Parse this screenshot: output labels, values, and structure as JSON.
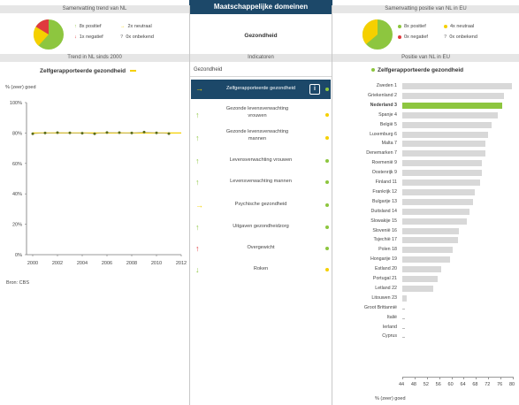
{
  "header": {
    "title": "Maatschappelijke domeinen",
    "left_summary_title": "Samenvatting trend van NL",
    "right_summary_title": "Samenvatting positie van NL in EU"
  },
  "trend_summary": {
    "items": [
      {
        "icon": "arrow-up-icon",
        "color": "#8dc63f",
        "text": "8x positief"
      },
      {
        "icon": "arrow-right-icon",
        "color": "#f5d000",
        "text": "2x neutraal"
      },
      {
        "icon": "arrow-down-icon",
        "color": "#e03a3e",
        "text": "1x negatief"
      },
      {
        "icon": "question-icon",
        "color": "#999999",
        "text": "0x onbekend"
      }
    ]
  },
  "domain_label": "Gezondheid",
  "eu_summary": {
    "items": [
      {
        "color": "#8dc63f",
        "text": "8x positief"
      },
      {
        "color": "#f5d000",
        "text": "4x neutraal"
      },
      {
        "color": "#e03a3e",
        "text": "0x negatief"
      },
      {
        "icon": "question-icon",
        "color": "#999999",
        "text": "0x onbekend"
      }
    ]
  },
  "sections": {
    "trend_title": "Trend in NL sinds 2000",
    "indicators_title": "Indicatoren",
    "position_title": "Positie van NL in EU"
  },
  "trend_chart": {
    "title": "Zelfgerapporteerde gezondheid",
    "ylabel": "% (zeer) goed",
    "source": "Bron: CBS"
  },
  "indicators": {
    "group_label": "Gezondheid",
    "info_label": "i",
    "items": [
      {
        "label": "Zelfgerapporteerde gezondheid",
        "arrow": "→",
        "arrow_color": "#f5d000",
        "dot_color": "#8dc63f",
        "selected": true
      },
      {
        "label": "Gezonde levensverwachting vrouwen",
        "arrow": "↑",
        "arrow_color": "#8dc63f",
        "dot_color": "#f5d000"
      },
      {
        "label": "Gezonde levensverwachting mannen",
        "arrow": "↑",
        "arrow_color": "#8dc63f",
        "dot_color": "#f5d000"
      },
      {
        "label": "Levensverwachting vrouwen",
        "arrow": "↑",
        "arrow_color": "#8dc63f",
        "dot_color": "#8dc63f"
      },
      {
        "label": "Levensverwachting mannen",
        "arrow": "↑",
        "arrow_color": "#8dc63f",
        "dot_color": "#8dc63f"
      },
      {
        "label": "Psychische gezondheid",
        "arrow": "→",
        "arrow_color": "#f5d000",
        "dot_color": "#8dc63f"
      },
      {
        "label": "Uitgaven gezondheidzorg",
        "arrow": "↑",
        "arrow_color": "#8dc63f",
        "dot_color": "#8dc63f"
      },
      {
        "label": "Overgewicht",
        "arrow": "↑",
        "arrow_color": "#e03a3e",
        "dot_color": "#8dc63f"
      },
      {
        "label": "Roken",
        "arrow": "↓",
        "arrow_color": "#8dc63f",
        "dot_color": "#f5d000"
      }
    ]
  },
  "colors": {
    "accent_dark": "#1c4869",
    "positive": "#8dc63f",
    "neutral": "#f5d000",
    "negative": "#e03a3e",
    "bar_default": "#d8d8d8",
    "bar_highlight": "#8dc63f"
  },
  "chart_data": [
    {
      "type": "line",
      "title": "Zelfgerapporteerde gezondheid",
      "ylabel": "% (zeer) goed",
      "x": [
        2000,
        2001,
        2002,
        2003,
        2004,
        2005,
        2006,
        2007,
        2008,
        2009,
        2010,
        2011
      ],
      "series": [
        {
          "values": [
            79.5,
            80.0,
            80.2,
            80.1,
            79.9,
            79.5,
            80.3,
            80.2,
            80.0,
            80.6,
            80.1,
            79.6
          ]
        }
      ],
      "trend_line": 80,
      "xticks": [
        "2000",
        "2002",
        "2004",
        "2006",
        "2008",
        "2010",
        "2012"
      ],
      "yticks": [
        "0%",
        "20%",
        "40%",
        "60%",
        "80%",
        "100%"
      ],
      "ylim": [
        0,
        100
      ],
      "xlim": [
        1999.5,
        2012
      ]
    },
    {
      "type": "bar",
      "title": "Zelfgerapporteerde gezondheid",
      "xlabel": "% (zeer) goed",
      "orientation": "horizontal",
      "xlim": [
        44,
        80
      ],
      "xticks": [
        "44",
        "48",
        "52",
        "56",
        "60",
        "64",
        "68",
        "72",
        "76",
        "80"
      ],
      "categories": [
        "Zweden 1",
        "Griekenland 2",
        "Nederland 3",
        "Spanje 4",
        "België 5",
        "Luxemburg 6",
        "Malta 7",
        "Denemarken 7",
        "Roemenië 9",
        "Oostenrijk 9",
        "Finland 11",
        "Frankrijk 12",
        "Bulgarije 13",
        "Duitsland 14",
        "Slowakije 15",
        "Slovenië 16",
        "Tsjechië 17",
        "Polen 18",
        "Hongarije 19",
        "Estland 20",
        "Portugal 21",
        "Letland 22",
        "Litouwen 23",
        "Groot Brittannië",
        "Italië",
        "Ierland",
        "Cyprus"
      ],
      "values": [
        79.6,
        77.0,
        76.5,
        75.2,
        73.0,
        71.8,
        71.0,
        71.0,
        69.8,
        69.8,
        69.2,
        67.6,
        67.0,
        66.0,
        65.0,
        62.4,
        62.0,
        60.4,
        59.5,
        56.6,
        55.6,
        54.2,
        45.5,
        null,
        null,
        null,
        null
      ],
      "highlight": "Nederland 3"
    }
  ]
}
